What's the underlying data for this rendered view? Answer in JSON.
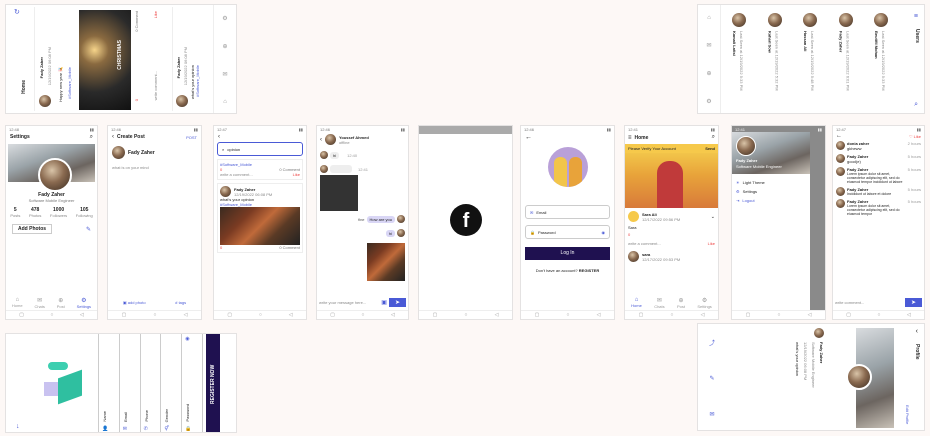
{
  "home_rot": {
    "title": "Home",
    "post1": {
      "name": "Fady Zaher",
      "date": "12/19/2022 06:08 PM",
      "text": "Happy new year 🎉",
      "hashtag": "#Software_Mobile",
      "image_text": "CHRISTMAS",
      "comments": "0 Comment",
      "likes": "0",
      "like": "Like",
      "write": "write comment..."
    },
    "post2": {
      "name": "Fady Zaher",
      "date": "12/19/2022 06:08 PM",
      "text": "what's your opinion",
      "hashtag": "#Software_Mobile"
    }
  },
  "users_rot": {
    "title": "Users",
    "users": [
      {
        "name": "Beutifil Mohan",
        "date": "Last Seen at 12/19/2022 5:33 PM"
      },
      {
        "name": "Fady Zaher",
        "date": "Last Seen at 12/19/2022 6:01 PM"
      },
      {
        "name": "Hassan Ali",
        "date": "Last Seen at 12/19/2022 5:48 PM"
      },
      {
        "name": "Kahari Sow",
        "date": "Last Seen at 12/19/2022 5:32 PM"
      },
      {
        "name": "Kamali Latisi",
        "date": "Last Seen at 12/19/2022 5:33 PM"
      }
    ]
  },
  "settings": {
    "title": "Settings",
    "name": "Fady Zaher",
    "role": "Software Mobile Engineer",
    "stats": [
      {
        "v": "5",
        "l": "Posts"
      },
      {
        "v": "478",
        "l": "Photos"
      },
      {
        "v": "1000",
        "l": "Followers"
      },
      {
        "v": "105",
        "l": "Following"
      }
    ],
    "add_photos": "Add Photos",
    "nav": [
      "Home",
      "Chats",
      "Post",
      "Settings"
    ]
  },
  "create_post": {
    "title": "Create Post",
    "post": "POST",
    "name": "Fady Zaher",
    "placeholder": "what is on your mind",
    "add_photo": "add photo",
    "tags": "# tags"
  },
  "search": {
    "label": "Search",
    "query": "opinion",
    "hashtag": "#Software_Mobile",
    "comments": "0 Comment",
    "likes": "0",
    "write": "write a comment...",
    "like": "Like",
    "name": "Fady Zaher",
    "date": "12/19/2022 06:08 PM",
    "text": "what's your opinion",
    "comments2": "0 Comment"
  },
  "chat": {
    "name": "Youssef Ahmed",
    "status": "offline",
    "msgs": [
      "hi",
      "12:40",
      "12:41",
      "fine",
      "hi"
    ],
    "bubble1": "How are you",
    "input": "write your message here..."
  },
  "login": {
    "email": "Email",
    "password": "Password",
    "login": "Log In",
    "noacc": "Don't have an account?",
    "register": "REGISTER"
  },
  "home": {
    "title": "Home",
    "banner": "Please Verify Your Account",
    "send": "Send",
    "name": "Sara Ali",
    "date": "12/17/2022 09:56 PM",
    "text": "Sara",
    "comment": "0",
    "write": "write a comment...",
    "like": "Like",
    "name2": "sara",
    "date2": "12/17/2022 09:53 PM",
    "nav": [
      "Home",
      "Chats",
      "Post",
      "Settings"
    ]
  },
  "drawer": {
    "name": "Fady Zaher",
    "role": "Software Mobile Engineer",
    "items": [
      "Light Theme",
      "Settings",
      "Logout"
    ]
  },
  "comments": {
    "title": "comments",
    "like": "Like",
    "entries": [
      {
        "name": "donia zaher",
        "text": "gkheww",
        "time": "2 hours"
      },
      {
        "name": "Fady Zaher",
        "text": "good(e)",
        "time": "5 hours"
      },
      {
        "name": "Fady Zaher",
        "text": "Lorem ipsum dolor sit amet, consectetur adipiscing elit, sed do eiusmod tempor incididunt ut labore",
        "time": "5 hours"
      },
      {
        "name": "Fady Zaher",
        "text": "Incididunt ut labore et dolore",
        "time": "5 hours"
      },
      {
        "name": "Fady Zaher",
        "text": "Lorem ipsum dolor sit amet, consectetur adipiscing elit, sed do eiusmod tempor",
        "time": "5 hours"
      }
    ],
    "write": "write comment..."
  },
  "register_rot": {
    "name": "Fady Zaher",
    "fields": [
      "Name",
      "Email",
      "Phone",
      "Gender",
      "Password"
    ],
    "button": "REGISTER NOW"
  },
  "profile_rot": {
    "title": "Profile",
    "name": "Fady Zaher",
    "role": "Software Mobile Engineer",
    "edit": "Edit Profile",
    "date": "12/19/2022 06:08 PM",
    "text": "what's your opinion"
  },
  "colors": {
    "dark": "#1f1150",
    "accent": "#4a5ad6",
    "yellow": "#f6c94b",
    "fb": "#111111"
  }
}
